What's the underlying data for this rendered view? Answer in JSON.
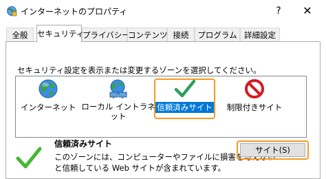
{
  "window": {
    "title": "インターネットのプロパティ",
    "help_label": "?",
    "close_label": "✕"
  },
  "tabs": [
    {
      "label": "全般",
      "active": false
    },
    {
      "label": "セキュリティ",
      "active": true
    },
    {
      "label": "プライバシー",
      "active": false
    },
    {
      "label": "コンテンツ",
      "active": false
    },
    {
      "label": "接続",
      "active": false
    },
    {
      "label": "プログラム",
      "active": false
    },
    {
      "label": "詳細設定",
      "active": false
    }
  ],
  "security": {
    "instruction": "セキュリティ設定を表示または変更するゾーンを選択してください。",
    "zones": [
      {
        "label": "インターネット",
        "icon": "globe-icon"
      },
      {
        "label": "ローカル イントラネット",
        "icon": "intranet-globe-icon"
      },
      {
        "label": "信頼済みサイト",
        "icon": "check-icon",
        "selected": true
      },
      {
        "label": "制限付きサイト",
        "icon": "no-entry-icon"
      }
    ],
    "selected_zone": {
      "title": "信頼済みサイト",
      "description_line1": "このゾーンには、コンピューターやファイルに損害を与えない",
      "description_line2": "と信頼している Web サイトが含まれています。"
    },
    "sites_button": "サイト(S)"
  },
  "colors": {
    "selection": "#0078d7",
    "highlight_outline": "#f59a23",
    "check_green": "#2e9e5b"
  }
}
